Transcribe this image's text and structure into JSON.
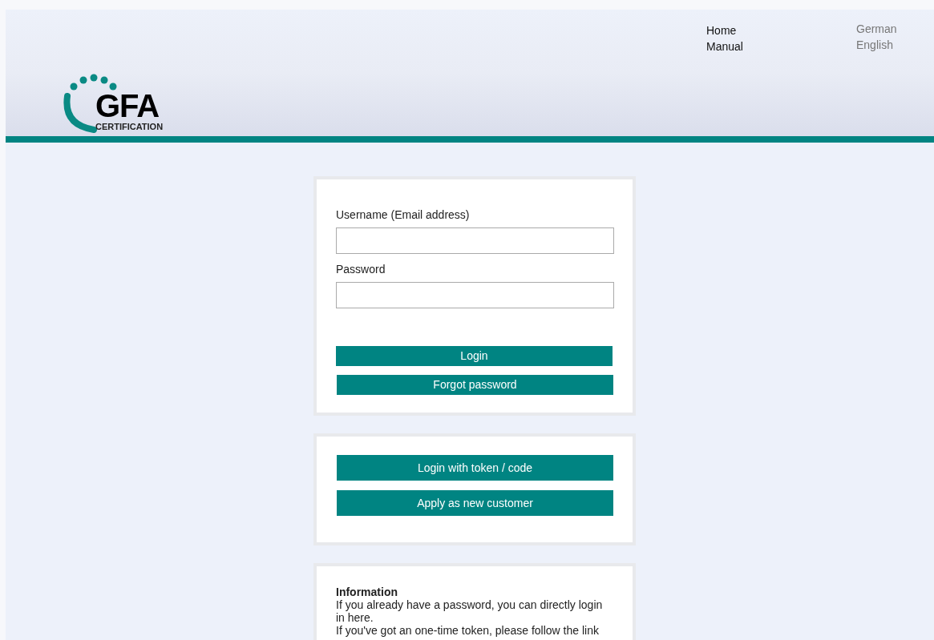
{
  "logo": {
    "name": "GFA",
    "subtitle": "CERTIFICATION"
  },
  "nav": [
    {
      "label": "Home"
    },
    {
      "label": "Manual"
    }
  ],
  "languages": [
    {
      "label": "German"
    },
    {
      "label": "English"
    }
  ],
  "login_form": {
    "username_label": "Username (Email address)",
    "password_label": "Password",
    "buttons": [
      "Login",
      "Forgot password"
    ]
  },
  "other_options": {
    "buttons": [
      "Login with token / code",
      "Apply as new customer"
    ]
  },
  "information": {
    "title": "Information",
    "lines": [
      "If you already have a password, you can directly login in here.",
      "If you've got an one-time token, please follow the link"
    ]
  }
}
